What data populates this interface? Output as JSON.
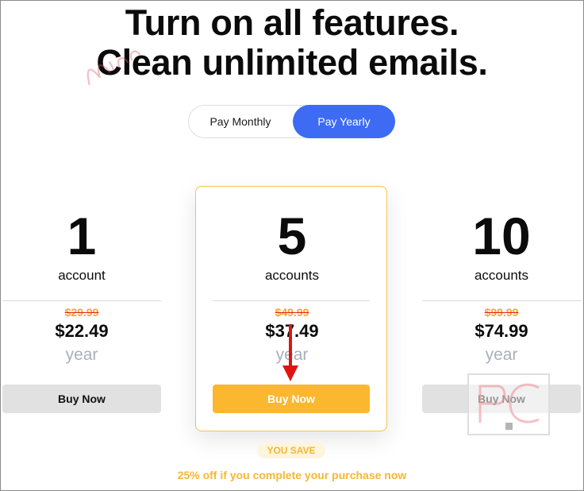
{
  "headline": {
    "line1": "Turn on all features.",
    "line2": "Clean unlimited emails."
  },
  "billing_toggle": {
    "monthly_label": "Pay Monthly",
    "yearly_label": "Pay Yearly",
    "selected": "yearly"
  },
  "plans": [
    {
      "count": "1",
      "unit": "account",
      "old_price": "$29.99",
      "price": "$22.49",
      "period": "year",
      "button_label": "Buy Now",
      "featured": false
    },
    {
      "count": "5",
      "unit": "accounts",
      "old_price": "$49.99",
      "price": "$37.49",
      "period": "year",
      "button_label": "Buy Now",
      "featured": true
    },
    {
      "count": "10",
      "unit": "accounts",
      "old_price": "$99.99",
      "price": "$74.99",
      "period": "year",
      "button_label": "Buy Now",
      "featured": false
    }
  ],
  "savings": {
    "badge": "YOU SAVE",
    "note": "25% off if you complete your purchase now"
  },
  "colors": {
    "accent_blue": "#3d6bf3",
    "accent_orange": "#fbb72e",
    "strike_red": "#e0221a",
    "muted_gray": "#a9b0bc"
  }
}
